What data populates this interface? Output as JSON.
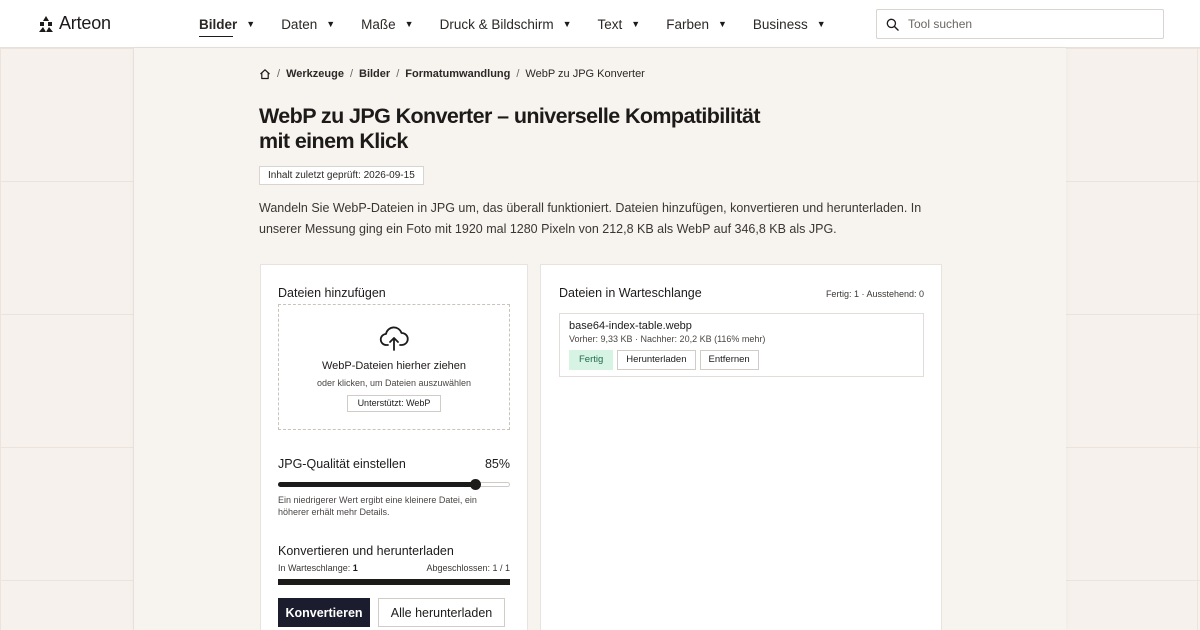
{
  "brand": {
    "name": "Arteon"
  },
  "nav": {
    "items": [
      {
        "label": "Bilder",
        "active": true
      },
      {
        "label": "Daten",
        "active": false
      },
      {
        "label": "Maße",
        "active": false
      },
      {
        "label": "Druck & Bildschirm",
        "active": false
      },
      {
        "label": "Text",
        "active": false
      },
      {
        "label": "Farben",
        "active": false
      },
      {
        "label": "Business",
        "active": false
      }
    ],
    "dropdown_icon": "caret-down-icon"
  },
  "search": {
    "placeholder": "Tool suchen",
    "icon": "search-icon"
  },
  "breadcrumb": {
    "home_icon": "home-icon",
    "items": [
      "Werkzeuge",
      "Bilder",
      "Formatumwandlung",
      "WebP zu JPG Konverter"
    ]
  },
  "page": {
    "title": "WebP zu JPG Konverter – universelle Kompatibilität mit einem Klick",
    "reviewed": "Inhalt zuletzt geprüft: 2026-09-15",
    "intro": "Wandeln Sie WebP-Dateien in JPG um, das überall funktioniert. Dateien hinzufügen, konvertieren und herunterladen. In unserer Messung ging ein Foto mit 1920 mal 1280 Pixeln von 212,8 KB als WebP auf 346,8 KB als JPG."
  },
  "upload": {
    "title": "Dateien hinzufügen",
    "icon": "cloud-upload-icon",
    "drop_text": "WebP-Dateien hierher ziehen",
    "click_text": "oder klicken, um Dateien auszuwählen",
    "supported": "Unterstützt: WebP"
  },
  "quality": {
    "label": "JPG-Qualität einstellen",
    "value_text": "85%",
    "value": 85,
    "hint": "Ein niedrigerer Wert ergibt eine kleinere Datei, ein höherer erhält mehr Details."
  },
  "convert": {
    "title": "Konvertieren und herunterladen",
    "queued_label": "In Warteschlange:",
    "queued_count": "1",
    "completed_text": "Abgeschlossen: 1 / 1",
    "progress": 1.0,
    "convert_button": "Konvertieren",
    "download_all_button": "Alle herunterladen"
  },
  "queue": {
    "title": "Dateien in Warteschlange",
    "status": "Fertig: 1 · Ausstehend: 0",
    "files": [
      {
        "name": "base64-index-table.webp",
        "sizes": "Vorher: 9,33 KB · Nachher: 20,2 KB (116% mehr)",
        "status": "Fertig",
        "download_label": "Herunterladen",
        "remove_label": "Entfernen"
      }
    ]
  },
  "colors": {
    "accent_dark": "#1b1d2e",
    "done_bg": "#d6f3e4",
    "done_text": "#1f6b48",
    "page_bg": "#f6f1ec"
  }
}
